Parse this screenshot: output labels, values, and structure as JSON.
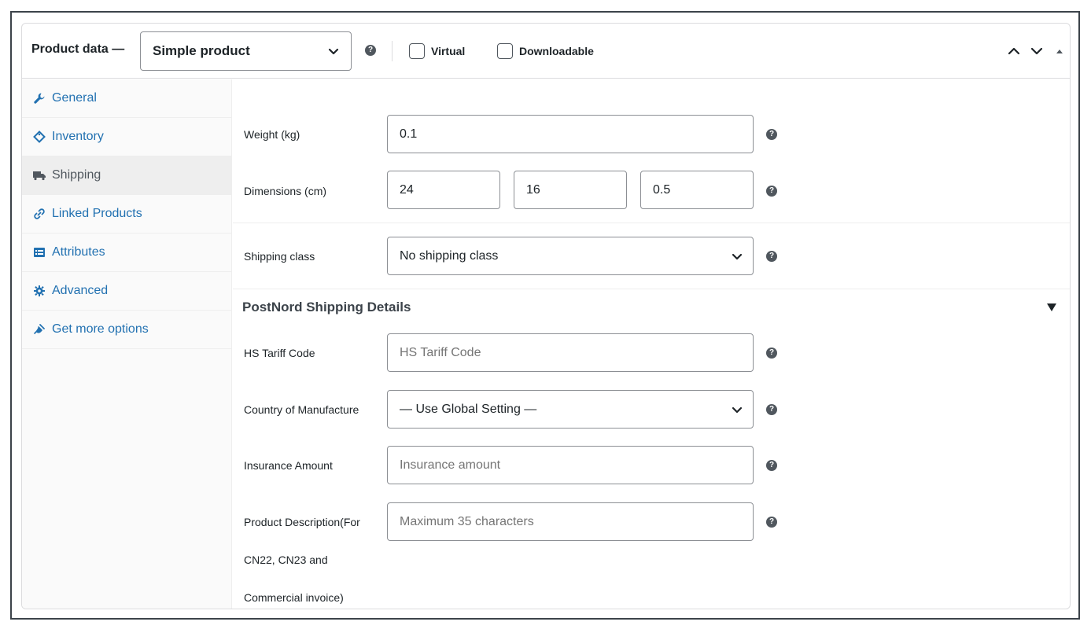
{
  "header": {
    "title": "Product data —",
    "product_type": "Simple product",
    "virtual_label": "Virtual",
    "downloadable_label": "Downloadable",
    "help_glyph": "?",
    "icons": [
      "chevron-down-icon",
      "help-icon",
      "arrow-up-icon",
      "arrow-down-icon",
      "collapse-triangle-icon"
    ]
  },
  "tabs": [
    {
      "label": "General",
      "icon": "wrench-icon"
    },
    {
      "label": "Inventory",
      "icon": "tag-icon"
    },
    {
      "label": "Shipping",
      "icon": "truck-icon",
      "active": true
    },
    {
      "label": "Linked Products",
      "icon": "link-icon"
    },
    {
      "label": "Attributes",
      "icon": "list-icon"
    },
    {
      "label": "Advanced",
      "icon": "gear-icon"
    },
    {
      "label": "Get more options",
      "icon": "plug-icon"
    }
  ],
  "shipping": {
    "weight_label": "Weight (kg)",
    "weight_value": "0.1",
    "dimensions_label": "Dimensions (cm)",
    "length_value": "24",
    "width_value": "16",
    "height_value": "0.5",
    "class_label": "Shipping class",
    "class_value": "No shipping class"
  },
  "postnord": {
    "section_title": "PostNord Shipping Details",
    "hs_label": "HS Tariff Code",
    "hs_placeholder": "HS Tariff Code",
    "country_label": "Country of Manufacture",
    "country_value": "— Use Global Setting —",
    "insurance_label": "Insurance Amount",
    "insurance_placeholder": "Insurance amount",
    "desc_label_1": "Product Description(For",
    "desc_label_2": "CN22, CN23 and",
    "desc_label_3": "Commercial invoice)",
    "desc_placeholder": "Maximum 35 characters"
  },
  "colors": {
    "link": "#2271b1",
    "active_tab_bg": "#eeeeee",
    "help_icon": "#50575e",
    "border": "#8c8f94"
  }
}
